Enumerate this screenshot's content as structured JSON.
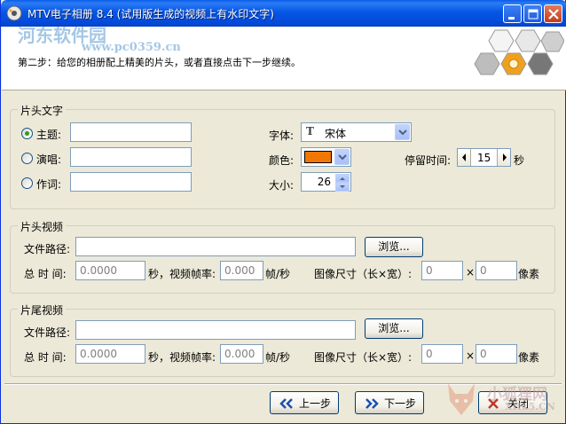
{
  "window": {
    "title": "MTV电子相册 8.4 (试用版生成的视频上有水印文字)"
  },
  "header": {
    "watermark_cn": "河东软件园",
    "watermark_url": "www.pc0359.cn",
    "step_text": "第二步：给您的相册配上精美的片头，或者直接点击下一步继续。"
  },
  "opening_text": {
    "legend": "片头文字",
    "radio_title_label": "主题:",
    "radio_singer_label": "演唱:",
    "radio_lyricist_label": "作词:",
    "title_value": "",
    "singer_value": "",
    "lyricist_value": "",
    "font_label": "字体:",
    "font_value": "宋体",
    "font_icon": "truetype-font-icon",
    "color_label": "颜色:",
    "color_value": "#f07800",
    "size_label": "大小:",
    "size_value": "26",
    "duration_label": "停留时间:",
    "duration_value": "15",
    "duration_unit": "秒",
    "selected_radio": "title"
  },
  "opening_video": {
    "legend": "片头视频",
    "path_label": "文件路径:",
    "path_value": "",
    "browse_label": "浏览...",
    "total_time_label": "总 时 间:",
    "total_time_value": "0.0000",
    "fps_label": "秒，视频帧率:",
    "fps_value": "0.000",
    "fps_unit": "帧/秒",
    "image_size_label": "图像尺寸（长×宽）:",
    "width_value": "0",
    "times": "×",
    "height_value": "0",
    "pixel_unit": "像素"
  },
  "ending_video": {
    "legend": "片尾视频",
    "path_label": "文件路径:",
    "path_value": "",
    "browse_label": "浏览...",
    "total_time_label": "总 时 间:",
    "total_time_value": "0.0000",
    "fps_label": "秒，视频帧率:",
    "fps_value": "0.000",
    "fps_unit": "帧/秒",
    "image_size_label": "图像尺寸（长×宽）:",
    "width_value": "0",
    "times": "×",
    "height_value": "0",
    "pixel_unit": "像素"
  },
  "footer": {
    "prev_label": "上一步",
    "next_label": "下一步",
    "close_label": "关闭",
    "watermark2_cn": "小狐狸网",
    "watermark2_url": "XHL5.CN"
  },
  "colors": {
    "accent": "#0556e5",
    "logo_orange": "#f0a020"
  }
}
